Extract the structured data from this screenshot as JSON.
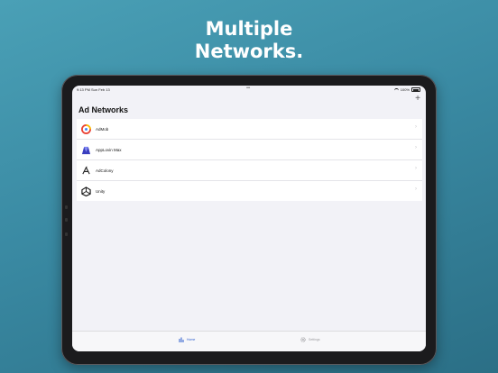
{
  "promo": {
    "line1": "Multiple",
    "line2": "Networks."
  },
  "status_bar": {
    "time": "9:13 PM",
    "date": "Sun Feb 13",
    "battery": "100%"
  },
  "nav": {
    "title": "Ad Networks",
    "add_icon": "plus-icon"
  },
  "networks": [
    {
      "name": "AdMob",
      "icon": "admob-logo"
    },
    {
      "name": "AppLovin Max",
      "icon": "applovin-logo"
    },
    {
      "name": "AdColony",
      "icon": "adcolony-logo"
    },
    {
      "name": "Unity",
      "icon": "unity-logo"
    }
  ],
  "tabs": [
    {
      "label": "Home",
      "icon": "bar-chart-icon",
      "active": true
    },
    {
      "label": "Settings",
      "icon": "gear-icon",
      "active": false
    }
  ],
  "colors": {
    "accent": "#2c5dcd",
    "background_top": "#4aa0b6",
    "background_bottom": "#2b6f86"
  }
}
